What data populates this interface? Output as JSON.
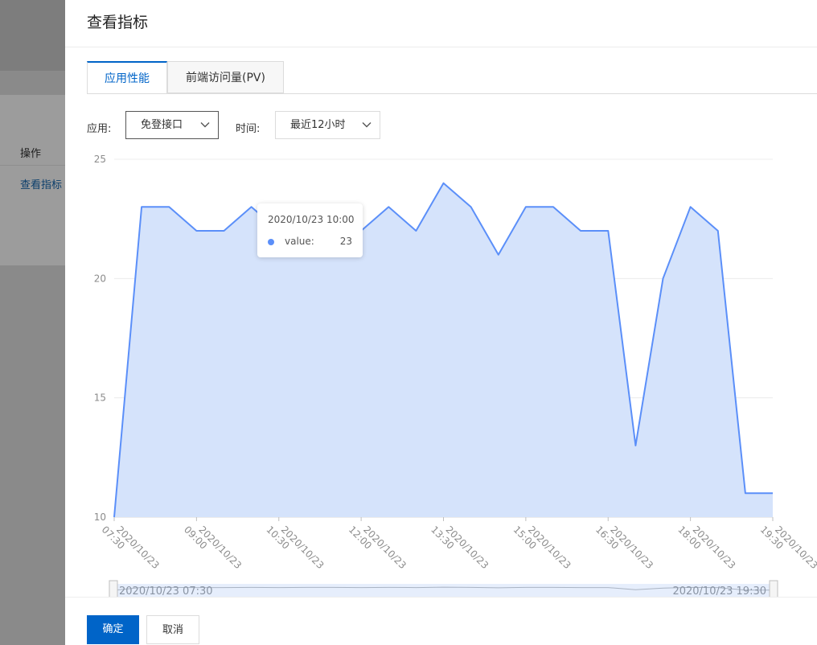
{
  "background_page": {
    "column_header": "操作",
    "row_action": "查看指标"
  },
  "drawer": {
    "title": "查看指标",
    "tabs": [
      {
        "label": "应用性能",
        "active": true
      },
      {
        "label": "前端访问量(PV)",
        "active": false
      }
    ],
    "filters": {
      "app_label": "应用:",
      "app_value": "免登接口",
      "time_label": "时间:",
      "time_value": "最近12小时"
    },
    "tooltip": {
      "title": "2020/10/23 10:00",
      "name": "value:",
      "value": "23"
    },
    "buttons": {
      "confirm": "确定",
      "cancel": "取消"
    }
  },
  "chart_data": {
    "type": "area",
    "y_ticks": [
      "25",
      "20",
      "15",
      "10"
    ],
    "ylim": [
      10,
      25
    ],
    "x_tick_labels": [
      "2020/10/23 07:30",
      "2020/10/23 09:00",
      "2020/10/23 10:30",
      "2020/10/23 12:00",
      "2020/10/23 13:30",
      "2020/10/23 15:00",
      "2020/10/23 16:30",
      "2020/10/23 18:00",
      "2020/10/23 19:30"
    ],
    "x": [
      "07:30",
      "08:00",
      "08:30",
      "09:00",
      "09:30",
      "10:00",
      "10:30",
      "11:00",
      "11:30",
      "12:00",
      "12:30",
      "13:00",
      "13:30",
      "14:00",
      "14:30",
      "15:00",
      "15:30",
      "16:00",
      "16:30",
      "17:00",
      "17:30",
      "18:00",
      "18:30",
      "19:00",
      "19:30"
    ],
    "values": [
      10,
      23,
      23,
      22,
      22,
      23,
      22,
      23,
      23,
      22,
      23,
      22,
      24,
      23,
      21,
      23,
      23,
      22,
      22,
      13,
      20,
      23,
      22,
      11,
      11
    ],
    "series_color": "#5b8ff9",
    "fill_color": "#d5e3fb",
    "slider": {
      "start_label": "2020/10/23 07:30",
      "end_label": "2020/10/23 19:30"
    }
  }
}
